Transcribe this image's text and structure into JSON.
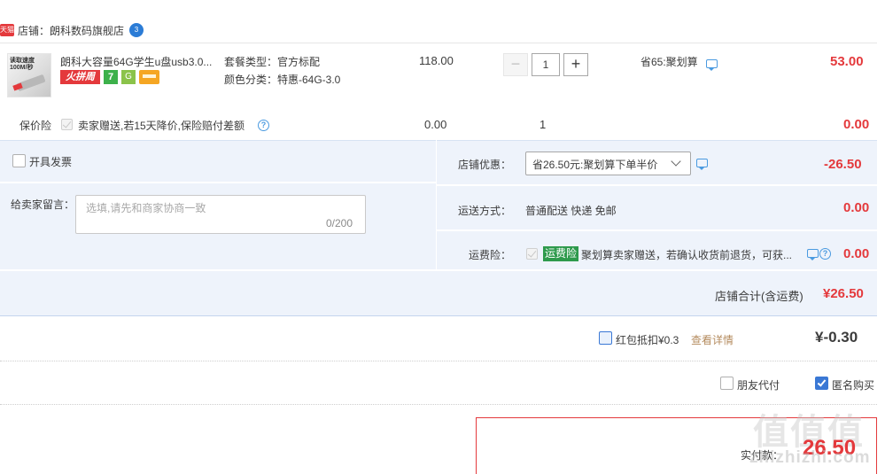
{
  "shop": {
    "platform_badge": "天猫",
    "label": "店铺：朗科数码旗舰店",
    "ww_badge": "3"
  },
  "item": {
    "title": "朗科大容量64G学生u盘usb3.0...",
    "thumb_text": "读取速度\n100M/秒",
    "badges": {
      "hot": "火拼周",
      "seven": "7",
      "g": "G"
    },
    "package_type": "套餐类型：官方标配",
    "color": "颜色分类：特惠-64G-3.0",
    "unit_price": "118.00",
    "qty_minus": "−",
    "qty_value": "1",
    "qty_plus": "+",
    "promo": "省65:聚划算",
    "total": "53.00"
  },
  "insurance": {
    "label": "保价险",
    "desc": "卖家赠送,若15天降价,保险赔付差额",
    "price": "0.00",
    "qty": "1",
    "total": "0.00"
  },
  "invoice": {
    "label": "开具发票"
  },
  "message": {
    "label": "给卖家留言：",
    "placeholder": "选填,请先和商家协商一致",
    "count": "0/200"
  },
  "shop_discount": {
    "label": "店铺优惠：",
    "selected": "省26.50元:聚划算下单半价",
    "value": "-26.50"
  },
  "shipping": {
    "label": "运送方式：",
    "method": "普通配送 快递 免邮",
    "value": "0.00"
  },
  "shipping_insurance": {
    "label": "运费险：",
    "tag": "运费险",
    "desc": "聚划算卖家赠送，若确认收货前退货，可获...",
    "value": "0.00"
  },
  "shop_total": {
    "label": "店铺合计(含运费)",
    "value": "¥26.50"
  },
  "red_packet": {
    "label": "红包抵扣¥0.3",
    "link": "查看详情",
    "value": "¥-0.30"
  },
  "options": {
    "friend_pay": "朋友代付",
    "anonymous": "匿名购买"
  },
  "payment": {
    "label": "实付款：",
    "value": "26.50"
  },
  "watermark": {
    "logo": "值值值",
    "site": "zhizhizhi.com"
  },
  "colors": {
    "accent_red": "#e4393c",
    "panel_blue": "#eef3fb",
    "link_blue": "#3a78d5"
  }
}
